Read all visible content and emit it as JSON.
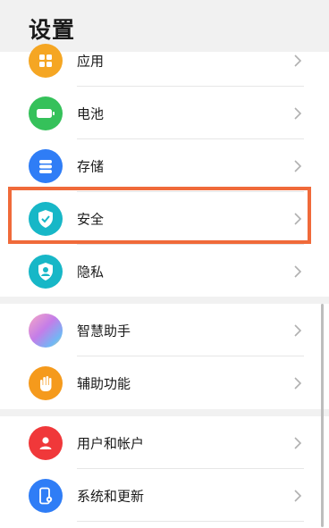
{
  "header": {
    "title": "设置"
  },
  "groups": [
    {
      "items": [
        {
          "label": "应用",
          "icon": "apps-icon",
          "color": "#f5a623"
        },
        {
          "label": "电池",
          "icon": "battery-icon",
          "color": "#35c15a"
        },
        {
          "label": "存储",
          "icon": "storage-icon",
          "color": "#2f7df6"
        },
        {
          "label": "安全",
          "icon": "shield-check-icon",
          "color": "#17b7c7",
          "highlighted": true
        },
        {
          "label": "隐私",
          "icon": "privacy-icon",
          "color": "#17b7c7"
        }
      ]
    },
    {
      "items": [
        {
          "label": "智慧助手",
          "icon": "assistant-icon",
          "color": "#c47de8"
        },
        {
          "label": "辅助功能",
          "icon": "hand-icon",
          "color": "#f59a1c"
        }
      ]
    },
    {
      "items": [
        {
          "label": "用户和帐户",
          "icon": "user-icon",
          "color": "#f0383a"
        },
        {
          "label": "系统和更新",
          "icon": "system-update-icon",
          "color": "#2f7df6"
        }
      ]
    }
  ],
  "highlight_color": "#f06a3a"
}
